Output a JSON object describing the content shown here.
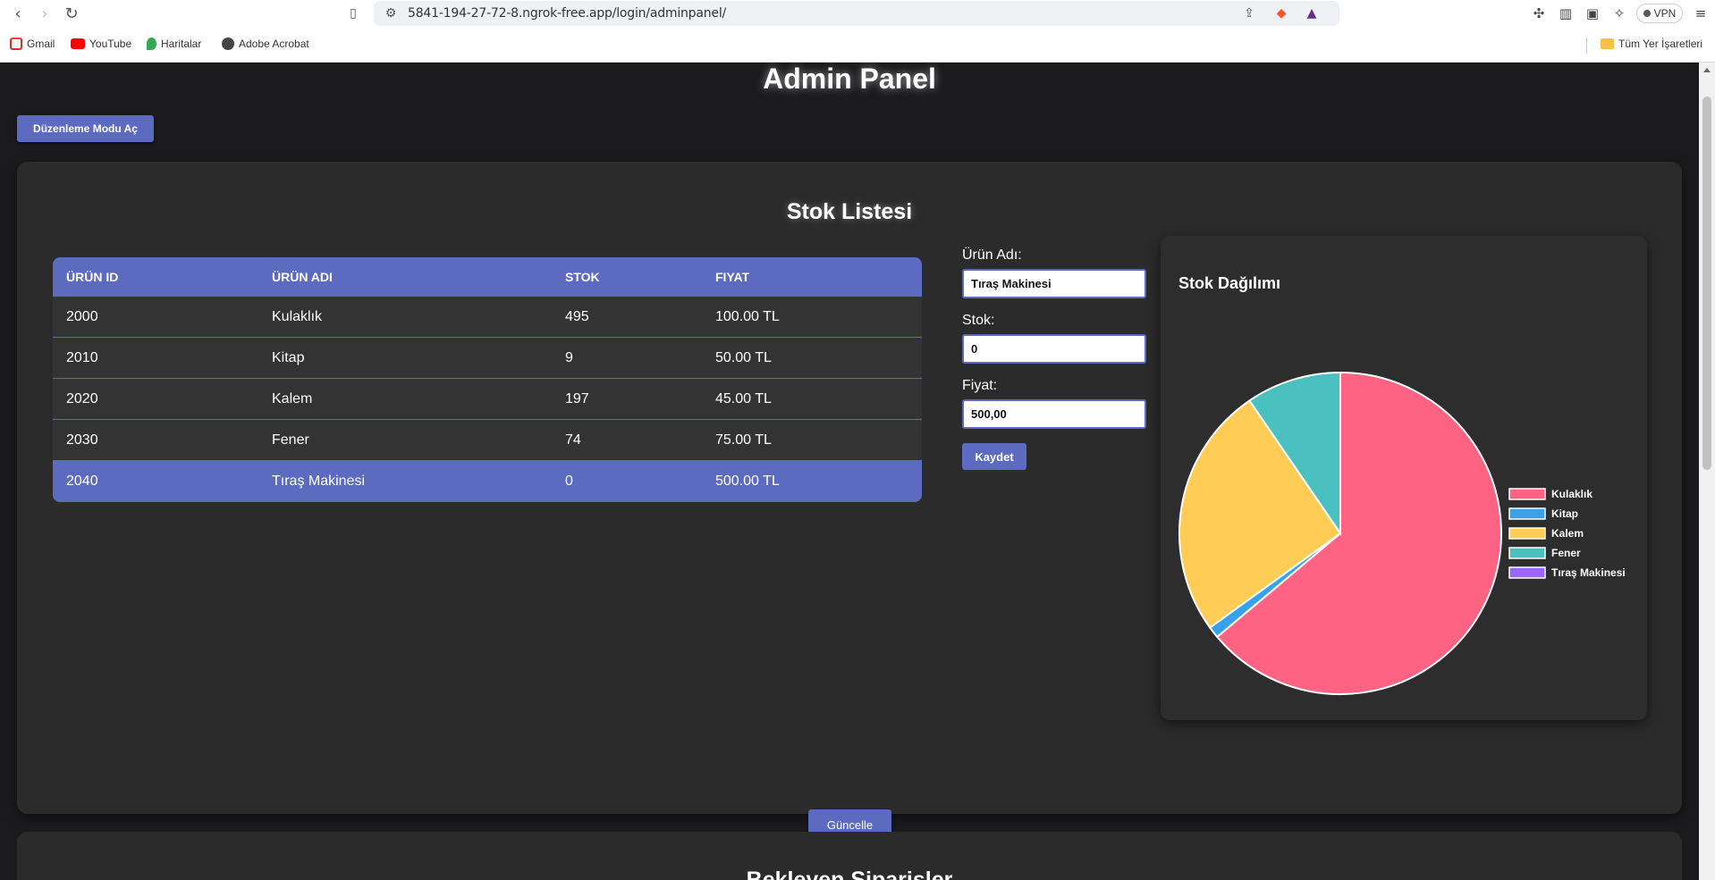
{
  "browser": {
    "url": "5841-194-27-72-8.ngrok-free.app/login/adminpanel/",
    "vpn_label": "VPN",
    "bookmarks": [
      {
        "label": "Gmail",
        "icon": "gmail-icon",
        "color": "#d93025"
      },
      {
        "label": "YouTube",
        "icon": "youtube-icon",
        "color": "#ff0000"
      },
      {
        "label": "Haritalar",
        "icon": "maps-icon",
        "color": "#34a853"
      },
      {
        "label": "Adobe Acrobat",
        "icon": "globe-icon",
        "color": "#444444"
      }
    ],
    "all_bookmarks": "Tüm Yer İşaretleri"
  },
  "page": {
    "title": "Admin Panel",
    "edit_mode_button": "Düzenleme Modu Aç",
    "update_button": "Güncelle",
    "next_section_title": "Bekleyen Siparişler"
  },
  "stock": {
    "title": "Stok Listesi",
    "columns": [
      "ÜRÜN ID",
      "ÜRÜN ADI",
      "STOK",
      "FIYAT"
    ],
    "rows": [
      {
        "id": "2000",
        "name": "Kulaklık",
        "stock": "495",
        "price": "100.00 TL"
      },
      {
        "id": "2010",
        "name": "Kitap",
        "stock": "9",
        "price": "50.00 TL"
      },
      {
        "id": "2020",
        "name": "Kalem",
        "stock": "197",
        "price": "45.00 TL"
      },
      {
        "id": "2030",
        "name": "Fener",
        "stock": "74",
        "price": "75.00 TL"
      },
      {
        "id": "2040",
        "name": "Tıraş Makinesi",
        "stock": "0",
        "price": "500.00 TL"
      }
    ],
    "selected_row": 4
  },
  "form": {
    "name_label": "Ürün Adı:",
    "name_value": "Tıraş Makinesi",
    "stock_label": "Stok:",
    "stock_value": "0",
    "price_label": "Fiyat:",
    "price_value": "500,00",
    "save_button": "Kaydet"
  },
  "chart_data": {
    "type": "pie",
    "title": "Stok Dağılımı",
    "categories": [
      "Kulaklık",
      "Kitap",
      "Kalem",
      "Fener",
      "Tıraş Makinesi"
    ],
    "values": [
      495,
      9,
      197,
      74,
      0
    ],
    "colors": [
      "#ff6384",
      "#36a2eb",
      "#ffcd56",
      "#4bc0c0",
      "#9966ff"
    ],
    "legend": "right"
  },
  "colors": {
    "accent": "#5c6bc0",
    "background": "#1b1b1d",
    "card": "#2b2b2b"
  }
}
